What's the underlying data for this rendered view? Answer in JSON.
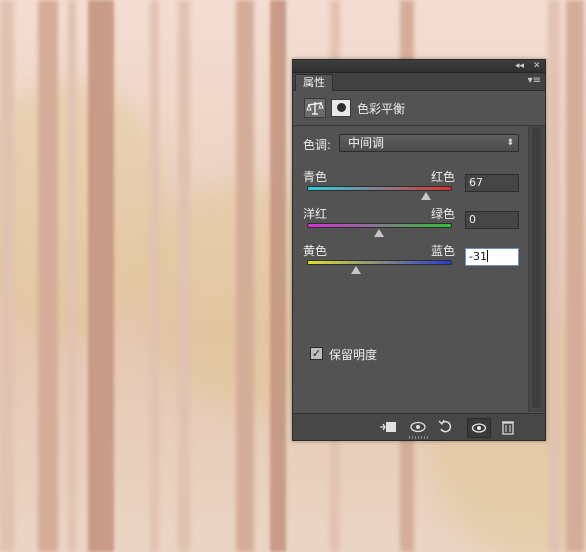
{
  "panel": {
    "tab_label": "属性",
    "collapse_glyph": "◂◂",
    "close_glyph": "✕",
    "menu_glyph": "▾≡",
    "adjustment_title": "色彩平衡"
  },
  "tone": {
    "label": "色调:",
    "selected": "中间调"
  },
  "sliders": [
    {
      "left": "青色",
      "right": "红色",
      "value": "67",
      "level": 0.835,
      "gradient": [
        "#2bd1e6",
        "#e03030"
      ]
    },
    {
      "left": "洋红",
      "right": "绿色",
      "value": "0",
      "level": 0.5,
      "gradient": [
        "#d431d4",
        "#2ec23a"
      ]
    },
    {
      "left": "黄色",
      "right": "蓝色",
      "value": "-31",
      "level": 0.345,
      "gradient": [
        "#e0e02a",
        "#2a3ad8"
      ]
    }
  ],
  "preserve": {
    "label": "保留明度",
    "checked": true
  },
  "colors": {
    "panel_bg": "#535353",
    "scene_fog": "#ecd2c3"
  }
}
